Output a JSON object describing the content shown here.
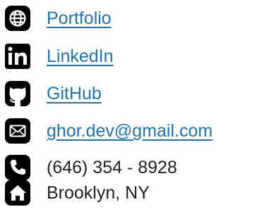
{
  "colors": {
    "link": "#1b73b3",
    "text": "#1f1f1f",
    "icon": "#000000"
  },
  "contacts": [
    {
      "icon": "globe-icon",
      "label": "Portfolio",
      "is_link": true
    },
    {
      "icon": "linkedin-icon",
      "label": "LinkedIn",
      "is_link": true
    },
    {
      "icon": "github-icon",
      "label": "GitHub",
      "is_link": true
    },
    {
      "icon": "envelope-icon",
      "label": "ghor.dev@gmail.com",
      "is_link": true
    },
    {
      "icon": "phone-icon",
      "label": "(646) 354 - 8928",
      "is_link": false
    },
    {
      "icon": "home-icon",
      "label": "Brooklyn, NY",
      "is_link": false
    }
  ]
}
